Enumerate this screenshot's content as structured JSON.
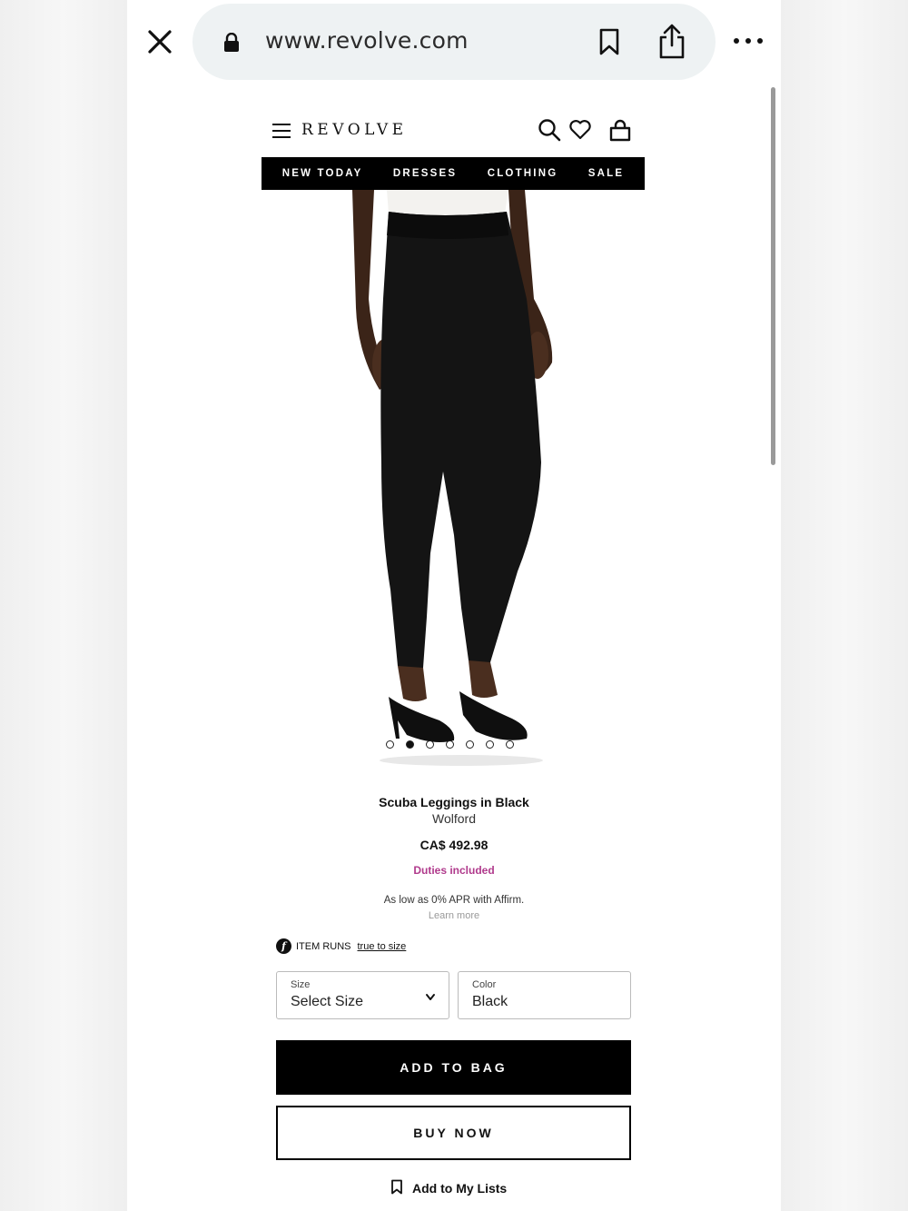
{
  "browser": {
    "url": "www.revolve.com",
    "icons": [
      "close-icon",
      "lock-icon",
      "bookmark-icon",
      "share-icon",
      "more-icon"
    ]
  },
  "site": {
    "logo": "REVOLVE",
    "header_icons": [
      "menu-icon",
      "search-icon",
      "heart-icon",
      "bag-icon"
    ],
    "nav": [
      "NEW TODAY",
      "DRESSES",
      "CLOTHING",
      "SALE"
    ]
  },
  "gallery": {
    "image_count": 7,
    "active_index": 1
  },
  "product": {
    "title": "Scuba Leggings in Black",
    "brand": "Wolford",
    "price": "CA$ 492.98",
    "duties": "Duties included",
    "affirm_text": "As low as 0% APR with Affirm.",
    "learn_more": "Learn more",
    "fit_prefix": "ITEM RUNS",
    "fit_link": "true to size"
  },
  "options": {
    "size_label": "Size",
    "size_value": "Select Size",
    "color_label": "Color",
    "color_value": "Black"
  },
  "actions": {
    "add_to_bag": "ADD TO BAG",
    "buy_now": "BUY NOW",
    "add_to_lists": "Add to My Lists"
  },
  "colors": {
    "nav_bg": "#000000",
    "duties": "#b03a8c",
    "urlbar": "#eef2f3"
  }
}
